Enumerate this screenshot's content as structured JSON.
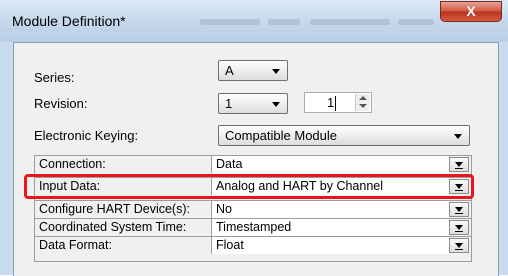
{
  "window": {
    "title": "Module Definition*",
    "close_label": "X"
  },
  "series": {
    "label": "Series:",
    "value": "A"
  },
  "revision": {
    "label": "Revision:",
    "major": "1",
    "minor": "1"
  },
  "keying": {
    "label": "Electronic Keying:",
    "value": "Compatible Module"
  },
  "grid": {
    "rows": [
      {
        "name": "Connection:",
        "value": "Data"
      },
      {
        "name": "Input Data:",
        "value": "Analog and HART by Channel"
      },
      {
        "name": "Configure HART Device(s):",
        "value": "No"
      },
      {
        "name": "Coordinated System Time:",
        "value": "Timestamped"
      },
      {
        "name": "Data Format:",
        "value": "Float"
      }
    ]
  },
  "colors": {
    "highlight": "#e8161a",
    "close": "#c9432c"
  }
}
